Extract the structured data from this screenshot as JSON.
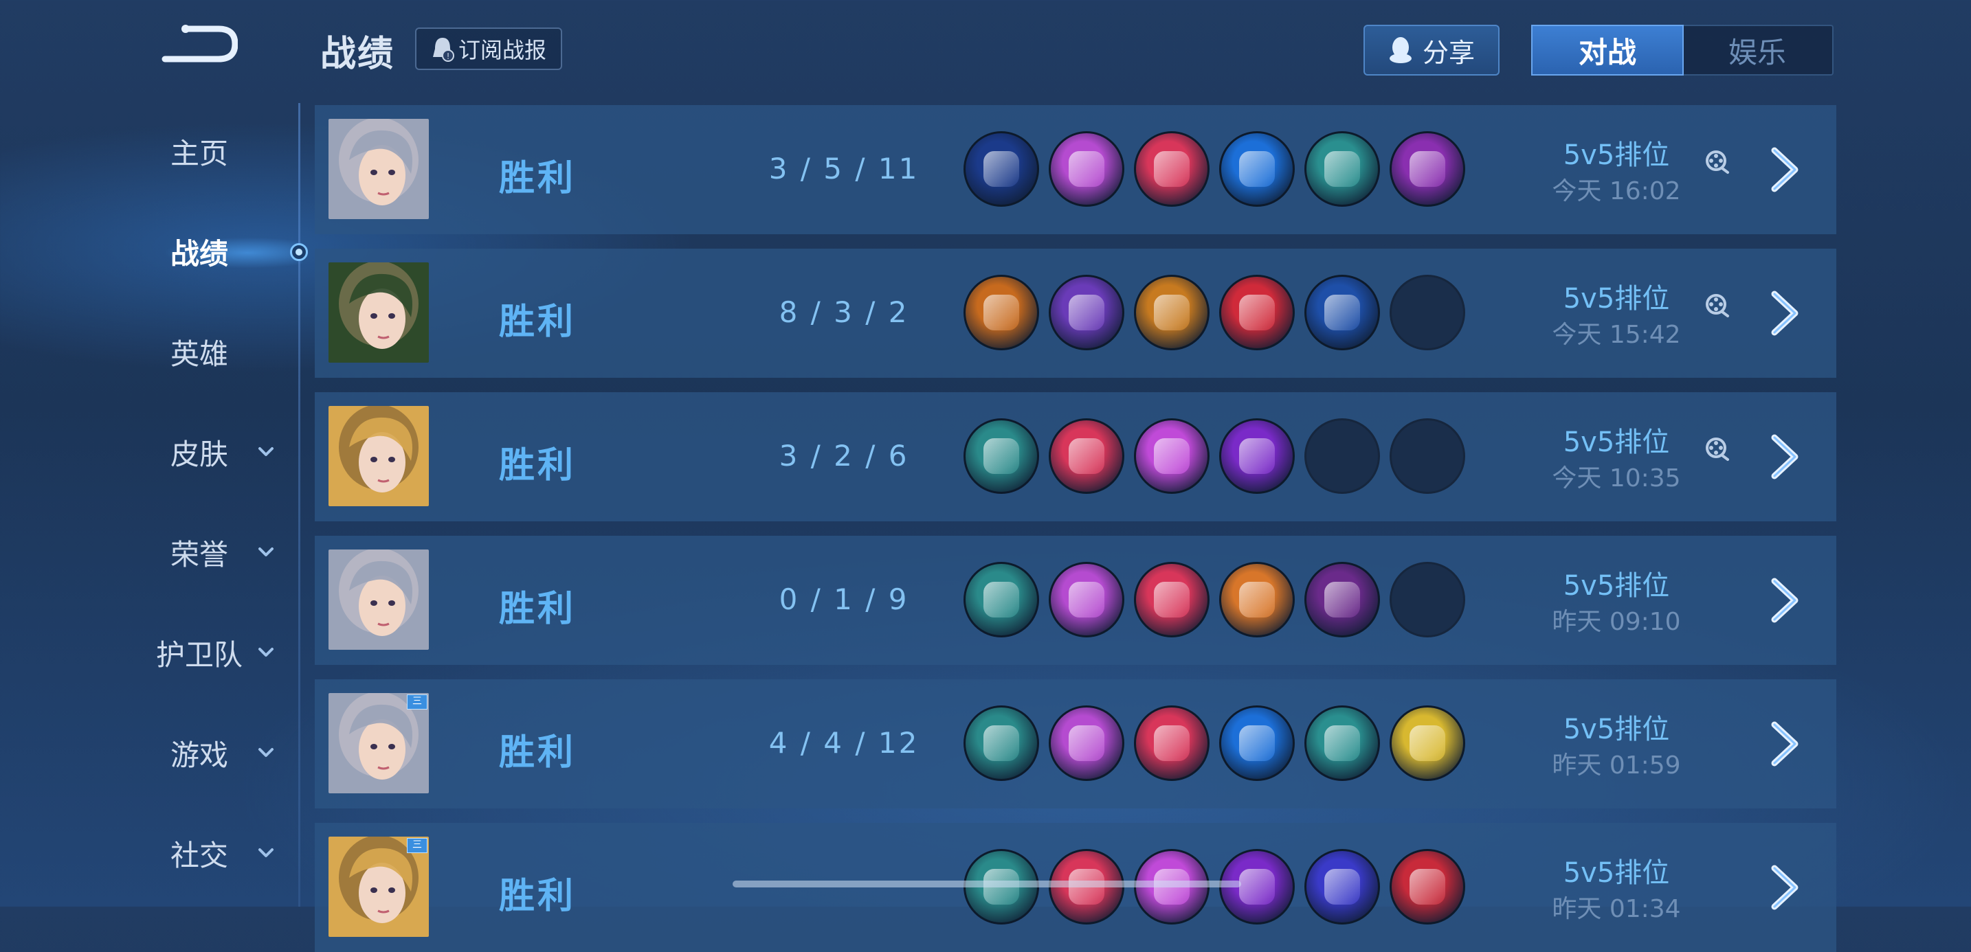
{
  "header": {
    "title": "战绩",
    "subscribe_label": "订阅战报",
    "share_label": "分享",
    "mode_tabs": [
      {
        "label": "对战",
        "active": true
      },
      {
        "label": "娱乐",
        "active": false
      }
    ]
  },
  "sidebar": {
    "items": [
      {
        "label": "主页",
        "has_chevron": false,
        "active": false
      },
      {
        "label": "战绩",
        "has_chevron": false,
        "active": true
      },
      {
        "label": "英雄",
        "has_chevron": false,
        "active": false
      },
      {
        "label": "皮肤",
        "has_chevron": true,
        "active": false
      },
      {
        "label": "荣誉",
        "has_chevron": true,
        "active": false
      },
      {
        "label": "护卫队",
        "has_chevron": true,
        "active": false
      },
      {
        "label": "游戏",
        "has_chevron": true,
        "active": false
      },
      {
        "label": "社交",
        "has_chevron": true,
        "active": false
      }
    ]
  },
  "matches": [
    {
      "result": "胜利",
      "kda": "3 / 5 / 11",
      "mode": "5v5排位",
      "time": "今天 16:02",
      "has_video": true,
      "badge": "",
      "hero_colors": [
        "#9aa3b8",
        "#e8d7d7"
      ],
      "items": [
        "#1b3a8a",
        "#b54bd0",
        "#d8365a",
        "#1c6fd8",
        "#2a8f8f",
        "#8a2fb0"
      ]
    },
    {
      "result": "胜利",
      "kda": "8 / 3 / 2",
      "mode": "5v5排位",
      "time": "今天 15:42",
      "has_video": true,
      "badge": "",
      "hero_colors": [
        "#2e4a2a",
        "#d9a884"
      ],
      "items": [
        "#c76a1e",
        "#6a3bb8",
        "#c77a20",
        "#d02a3a",
        "#1e4fa8",
        ""
      ]
    },
    {
      "result": "胜利",
      "kda": "3 / 2 / 6",
      "mode": "5v5排位",
      "time": "今天 10:35",
      "has_video": true,
      "badge": "",
      "hero_colors": [
        "#d8a850",
        "#3a2618"
      ],
      "items": [
        "#2a8a8a",
        "#d8365a",
        "#c04ad8",
        "#7a2ac8",
        "",
        ""
      ]
    },
    {
      "result": "胜利",
      "kda": "0 / 1 / 9",
      "mode": "5v5排位",
      "time": "昨天 09:10",
      "has_video": false,
      "badge": "",
      "hero_colors": [
        "#9aa3b8",
        "#e8d7d7"
      ],
      "items": [
        "#2a8a8a",
        "#b54bd0",
        "#d8365a",
        "#d8762a",
        "#6a2a8a",
        ""
      ]
    },
    {
      "result": "胜利",
      "kda": "4 / 4 / 12",
      "mode": "5v5排位",
      "time": "昨天 01:59",
      "has_video": false,
      "badge": "三",
      "hero_colors": [
        "#9aa3b8",
        "#e8d7d7"
      ],
      "items": [
        "#2a8a8a",
        "#b54bd0",
        "#d8365a",
        "#1c6fd8",
        "#2a8f8f",
        "#d8b830"
      ]
    },
    {
      "result": "胜利",
      "kda": "",
      "mode": "5v5排位",
      "time": "昨天 01:34",
      "has_video": false,
      "badge": "三",
      "hero_colors": [
        "#d8a850",
        "#3a2618"
      ],
      "items": [
        "#2a8a8a",
        "#d8365a",
        "#c04ad8",
        "#7a2ac8",
        "#3a3ac8",
        "#c82a3a"
      ]
    }
  ]
}
